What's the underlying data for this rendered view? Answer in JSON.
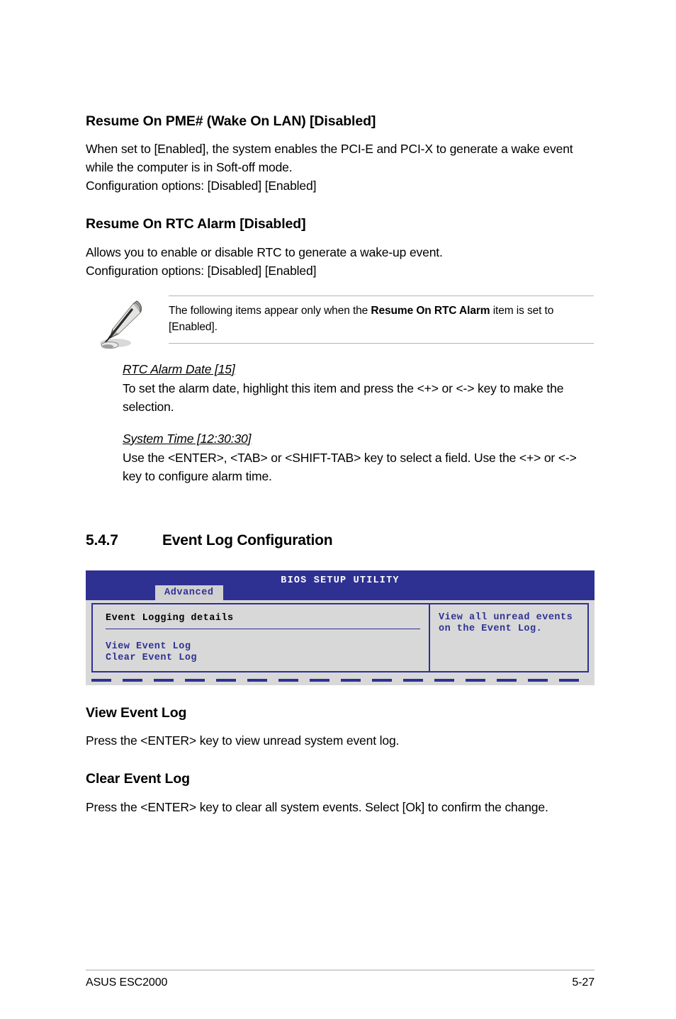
{
  "sections": [
    {
      "heading": "Resume On PME# (Wake On LAN) [Disabled]",
      "paragraph": "When set to [Enabled], the system enables the PCI-E and PCI-X to generate a wake event while the computer is in Soft-off mode.",
      "options_line": "Configuration options: [Disabled] [Enabled]"
    },
    {
      "heading": "Resume On RTC Alarm [Disabled]",
      "paragraph": "Allows you to enable or disable RTC to generate a wake-up event.",
      "options_line": "Configuration options: [Disabled] [Enabled]"
    }
  ],
  "note": {
    "icon": "pencil-note-icon",
    "text_before": "The following items appear only when the ",
    "text_bold": "Resume On RTC Alarm",
    "text_after": " item is set to [Enabled]."
  },
  "sub_items": [
    {
      "title": "RTC Alarm Date [15]",
      "description": "To set the alarm date, highlight this item and press the <+> or <-> key to make the selection."
    },
    {
      "title": "System Time [12:30:30]",
      "description": "Use the <ENTER>, <TAB> or <SHIFT-TAB> key to select a field. Use the <+> or <-> key to configure alarm time."
    }
  ],
  "section_547": {
    "number": "5.4.7",
    "title": "Event Log Configuration"
  },
  "bios": {
    "title": "BIOS SETUP UTILITY",
    "active_tab": "Advanced",
    "group_title": "Event Logging details",
    "items": [
      "View Event Log",
      "Clear Event Log"
    ],
    "help_line_1": "View all unread events",
    "help_line_2": "on the Event Log.",
    "colors": {
      "header_blue": "#2e3192",
      "panel_gray": "#d8d8d8",
      "tab_gray": "#d0d0d0"
    }
  },
  "post_sections": [
    {
      "heading": "View Event Log",
      "paragraph": "Press the <ENTER> key to view unread system event log."
    },
    {
      "heading": "Clear Event Log",
      "paragraph": "Press the <ENTER> key to clear all system events. Select [Ok] to confirm the change."
    }
  ],
  "footer": {
    "left": "ASUS ESC2000",
    "right": "5-27"
  }
}
